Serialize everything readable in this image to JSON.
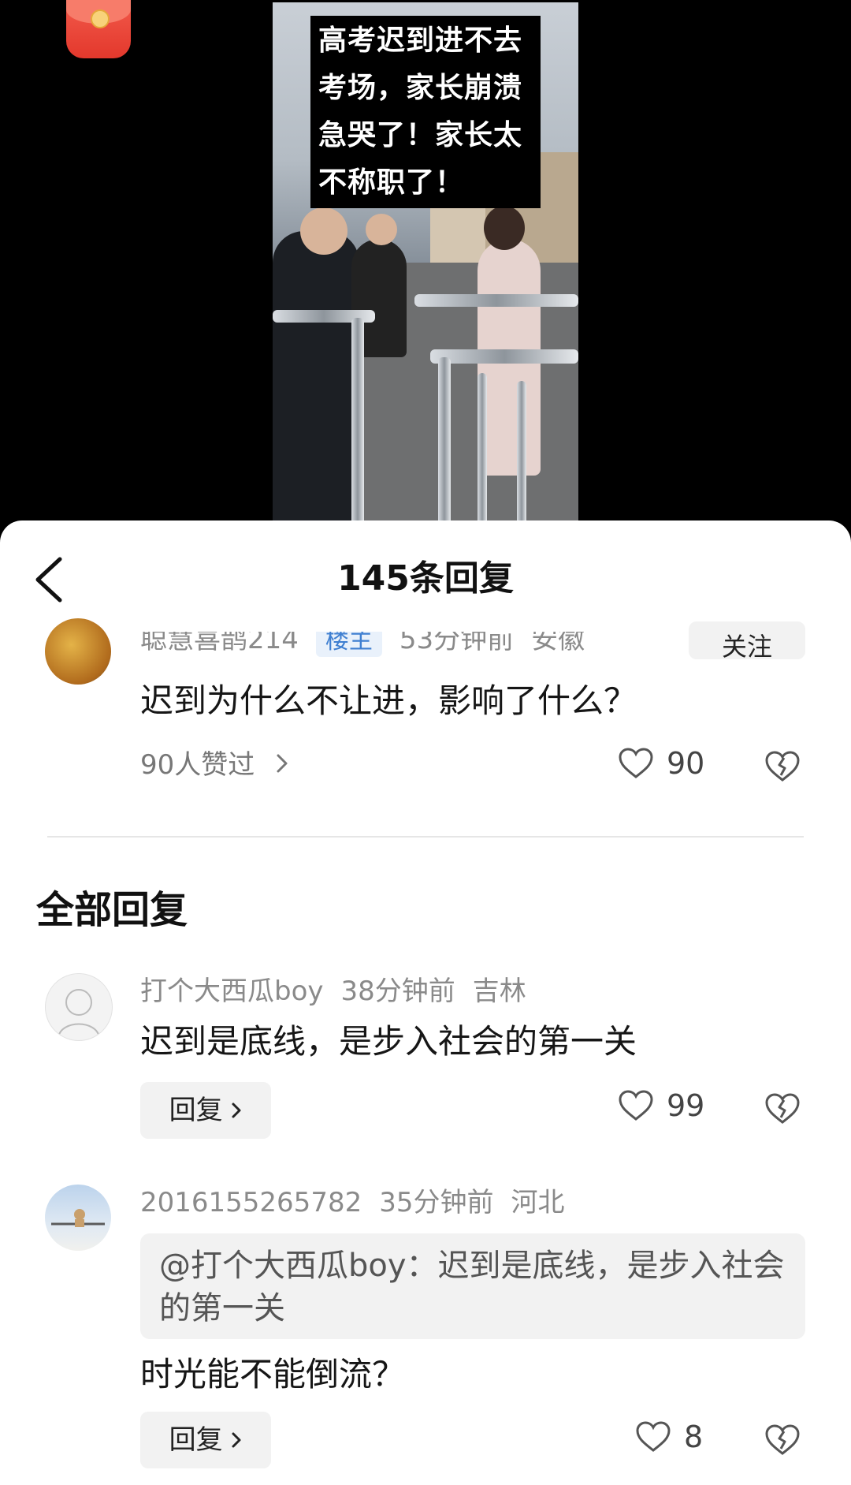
{
  "video": {
    "caption_lines": [
      "高考迟到进不去",
      "考场，家长崩溃",
      "急哭了！家长太",
      "不称职了！"
    ]
  },
  "sheet": {
    "title": "145条回复",
    "pinned": {
      "author": "聪慧喜鹊214",
      "badge": "楼主",
      "time": "53分钟前",
      "location": "安徽",
      "follow_label": "关注",
      "text": "迟到为什么不让进，影响了什么？",
      "liked_by": "90人赞过",
      "likes": "90"
    },
    "section_title": "全部回复",
    "replies": [
      {
        "author": "打个大西瓜boy",
        "time": "38分钟前",
        "location": "吉林",
        "text": "迟到是底线，是步入社会的第一关",
        "reply_label": "回复",
        "likes": "99"
      },
      {
        "author": "2016155265782",
        "time": "35分钟前",
        "location": "河北",
        "quote": "@打个大西瓜boy：迟到是底线，是步入社会的第一关",
        "text": "时光能不能倒流？",
        "reply_label": "回复",
        "likes": "8"
      }
    ],
    "icons": {
      "back": "chevron-left-icon",
      "like": "heart-icon",
      "dislike": "broken-heart-icon",
      "red_packet": "red-packet-icon"
    }
  }
}
